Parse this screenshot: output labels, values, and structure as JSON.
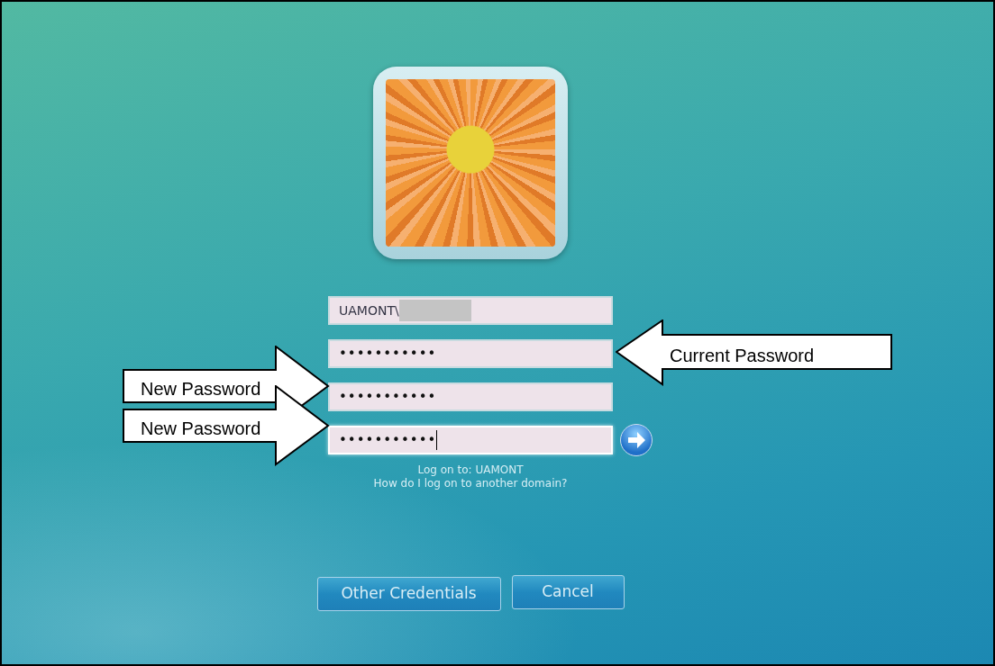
{
  "fields": [
    {
      "kind": "text",
      "value": "UAMONT\\",
      "redacted": true,
      "focused": false
    },
    {
      "kind": "password",
      "value": "•••••••••••",
      "redacted": false,
      "focused": false
    },
    {
      "kind": "password",
      "value": "•••••••••••",
      "redacted": false,
      "focused": false
    },
    {
      "kind": "password",
      "value": "•••••••••••",
      "redacted": false,
      "focused": true
    }
  ],
  "logon_to": "Log on to: UAMONT",
  "domain_link": "How do I log on to another domain?",
  "buttons": [
    "Other Credentials",
    "Cancel"
  ],
  "callouts": [
    {
      "text": "Current Password",
      "kind": "left"
    },
    {
      "text": "New Password",
      "kind": "right"
    },
    {
      "text": "New Password",
      "kind": "right"
    }
  ]
}
